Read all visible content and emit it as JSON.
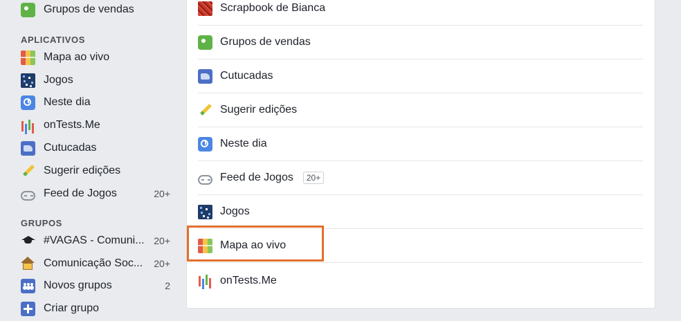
{
  "sidebar": {
    "top_item": {
      "label": "Grupos de vendas",
      "icon": "tag-icon"
    },
    "apps_header": "APLICATIVOS",
    "apps": [
      {
        "label": "Mapa ao vivo",
        "icon": "map-icon",
        "count": ""
      },
      {
        "label": "Jogos",
        "icon": "games-icon",
        "count": ""
      },
      {
        "label": "Neste dia",
        "icon": "clock-icon",
        "count": ""
      },
      {
        "label": "onTests.Me",
        "icon": "bars-icon",
        "count": ""
      },
      {
        "label": "Cutucadas",
        "icon": "poke-icon",
        "count": ""
      },
      {
        "label": "Sugerir edições",
        "icon": "pencil-icon",
        "count": ""
      },
      {
        "label": "Feed de Jogos",
        "icon": "gamepad-icon",
        "count": "20+"
      }
    ],
    "groups_header": "GRUPOS",
    "groups": [
      {
        "label": "#VAGAS - Comuni...",
        "icon": "graduation-cap-icon",
        "count": "20+"
      },
      {
        "label": "Comunicação Soc...",
        "icon": "house-icon",
        "count": "20+"
      },
      {
        "label": "Novos grupos",
        "icon": "group-icon",
        "count": "2"
      },
      {
        "label": "Criar grupo",
        "icon": "plus-icon",
        "count": ""
      }
    ]
  },
  "main": {
    "rows": [
      {
        "label": "Scrapbook de Bianca",
        "icon": "scrapbook-icon",
        "badge": ""
      },
      {
        "label": "Grupos de vendas",
        "icon": "tag-icon",
        "badge": ""
      },
      {
        "label": "Cutucadas",
        "icon": "poke-icon",
        "badge": ""
      },
      {
        "label": "Sugerir edições",
        "icon": "pencil-icon",
        "badge": ""
      },
      {
        "label": "Neste dia",
        "icon": "clock-icon",
        "badge": ""
      },
      {
        "label": "Feed de Jogos",
        "icon": "gamepad-icon",
        "badge": "20+"
      },
      {
        "label": "Jogos",
        "icon": "games-icon",
        "badge": ""
      },
      {
        "label": "Mapa ao vivo",
        "icon": "map-icon",
        "badge": ""
      },
      {
        "label": "onTests.Me",
        "icon": "bars-icon",
        "badge": ""
      }
    ],
    "highlighted_row": "Mapa ao vivo"
  },
  "colors": {
    "page_bg": "#e9ebee",
    "card_bg": "#ffffff",
    "highlight_border": "#e36f2a",
    "text": "#1d2129"
  }
}
